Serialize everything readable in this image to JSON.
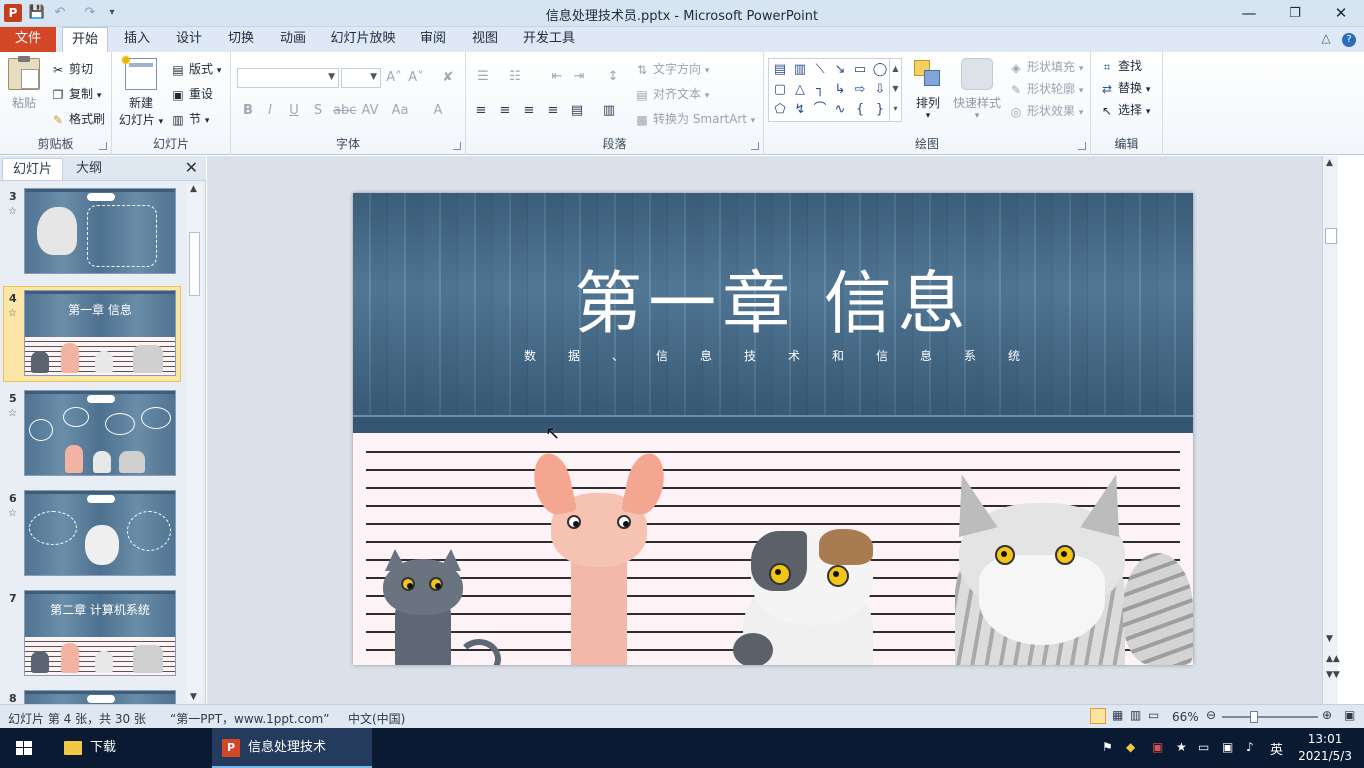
{
  "window": {
    "title": "信息处理技术员.pptx - Microsoft PowerPoint",
    "app_icon_letter": "P"
  },
  "tabs": [
    {
      "label": "文件",
      "key": "file"
    },
    {
      "label": "开始",
      "key": "home"
    },
    {
      "label": "插入",
      "key": "insert"
    },
    {
      "label": "设计",
      "key": "design"
    },
    {
      "label": "切换",
      "key": "transitions"
    },
    {
      "label": "动画",
      "key": "animations"
    },
    {
      "label": "幻灯片放映",
      "key": "slideshow"
    },
    {
      "label": "审阅",
      "key": "review"
    },
    {
      "label": "视图",
      "key": "view"
    },
    {
      "label": "开发工具",
      "key": "developer"
    }
  ],
  "ribbon": {
    "clipboard": {
      "label": "剪贴板",
      "paste": "粘贴",
      "cut": "剪切",
      "copy": "复制",
      "format_painter": "格式刷"
    },
    "slides": {
      "label": "幻灯片",
      "new_slide_1": "新建",
      "new_slide_2": "幻灯片",
      "layout": "版式",
      "reset": "重设",
      "section": "节"
    },
    "font": {
      "label": "字体"
    },
    "paragraph": {
      "label": "段落",
      "text_direction": "文字方向",
      "align_text": "对齐文本",
      "convert_smartart": "转换为 SmartArt"
    },
    "drawing": {
      "label": "绘图",
      "arrange": "排列",
      "quick_styles": "快速样式",
      "shape_fill": "形状填充",
      "shape_outline": "形状轮廓",
      "shape_effects": "形状效果"
    },
    "editing": {
      "label": "编辑",
      "find": "查找",
      "replace": "替换",
      "select": "选择"
    }
  },
  "left_panel": {
    "tab_slides": "幻灯片",
    "tab_outline": "大纲",
    "thumbnails": [
      {
        "number": "3",
        "title": ""
      },
      {
        "number": "4",
        "title": "第一章 信息",
        "selected": true
      },
      {
        "number": "5",
        "title": ""
      },
      {
        "number": "6",
        "title": ""
      },
      {
        "number": "7",
        "title": "第二章 计算机系统"
      },
      {
        "number": "8",
        "title": ""
      }
    ]
  },
  "slide": {
    "title": "第一章 信息",
    "subtitle": "数据、信息技术和信息系统"
  },
  "status": {
    "slide_info": "幻灯片 第 4 张，共 30 张",
    "theme": "“第一PPT，www.1ppt.com”",
    "language": "中文(中国)",
    "zoom": "66%",
    "zoom_fraction": 0.66
  },
  "taskbar": {
    "downloads": "下载",
    "active_task": "信息处理技术员.pp...",
    "ime": "英",
    "time": "13:01",
    "date": "2021/5/3"
  }
}
